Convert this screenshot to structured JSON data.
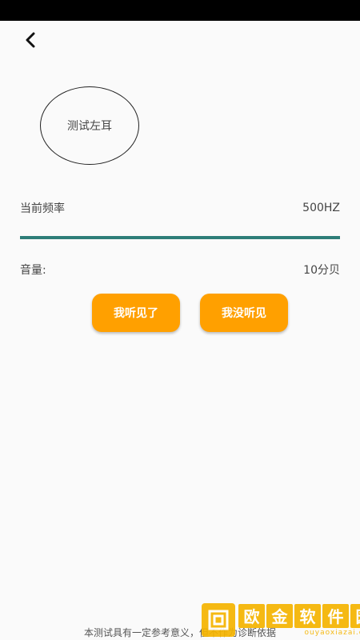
{
  "header": {
    "back_icon": "chevron-left-icon"
  },
  "test": {
    "ear_label": "测试左耳"
  },
  "frequency": {
    "label": "当前频率",
    "value": "500HZ",
    "accent_color": "#2e7d78"
  },
  "volume": {
    "label": "音量:",
    "value": "10分贝"
  },
  "buttons": {
    "heard_label": "我听见了",
    "not_heard_label": "我没听见",
    "color": "#ffa000"
  },
  "footer": {
    "disclaimer": "本测试具有一定参考意义，但不作为诊断依据"
  },
  "watermark": {
    "title_chars": [
      "欧",
      "金",
      "软",
      "件",
      "园"
    ],
    "url": "ouyaoxiazai.com",
    "color": "#f5b400"
  }
}
